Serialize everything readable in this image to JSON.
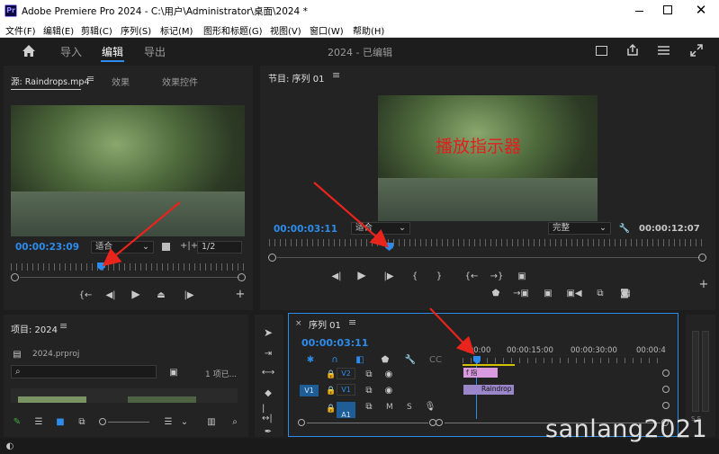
{
  "title_bar": {
    "app_name": "Adobe Premiere Pro 2024 - C:\\用户\\Administrator\\桌面\\2024 *",
    "badge": "Pr"
  },
  "menu": [
    "文件(F)",
    "编辑(E)",
    "剪辑(C)",
    "序列(S)",
    "标记(M)",
    "图形和标题(G)",
    "视图(V)",
    "窗口(W)",
    "帮助(H)"
  ],
  "toolbar": {
    "import": "导入",
    "edit": "编辑",
    "export": "导出",
    "project_status": "2024 - 已编辑"
  },
  "source_panel": {
    "tab_source": "源: Raindrops.mp4",
    "tab_effects": "效果",
    "tab_effect_controls": "效果控件",
    "timecode": "00:00:23:09",
    "fit": "适合",
    "ratio": "1/2"
  },
  "program_panel": {
    "title": "节目: 序列 01",
    "timecode": "00:00:03:11",
    "fit": "适合",
    "quality": "完整",
    "duration": "00:00:12:07",
    "annotation": "播放指示器"
  },
  "project_panel": {
    "title": "项目: 2024",
    "file": "2024.prproj",
    "search_placeholder": "",
    "count": "1 项已..."
  },
  "timeline_panel": {
    "title": "序列 01",
    "timecode": "00:00:03:11",
    "ruler": [
      ":00:00",
      "00:00:15:00",
      "00:00:30:00",
      "00:00:4"
    ],
    "tracks": [
      {
        "toggle": "",
        "name": "V2"
      },
      {
        "toggle": "V1",
        "name": "V1"
      },
      {
        "toggle": "",
        "name": "A1"
      }
    ],
    "clip_v2": "f 指",
    "clip_v1": "Raindrop",
    "audio_letters": [
      "M",
      "S"
    ]
  },
  "audio_meter": {
    "labels": "S  S"
  },
  "watermark": "sanlang2021",
  "colors": {
    "accent": "#2d8ceb",
    "arrow": "#e8241c",
    "clip_v2": "#d99ae0",
    "clip_v1": "#9b86c9",
    "panel": "#232323"
  }
}
